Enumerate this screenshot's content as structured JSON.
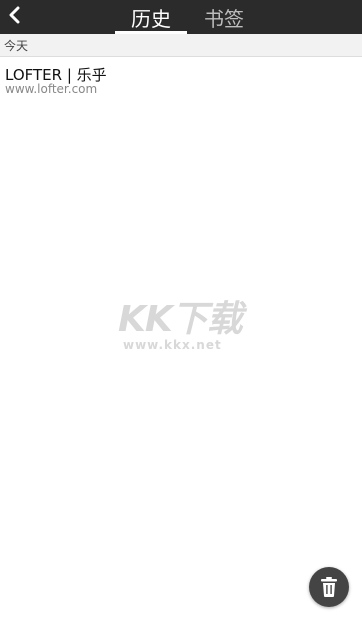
{
  "header": {
    "back_icon": "chevron-left-icon",
    "tabs": [
      {
        "label": "历史",
        "active": true
      },
      {
        "label": "书签",
        "active": false
      }
    ],
    "background_color": "#2b2b2b"
  },
  "history": {
    "sections": [
      {
        "label": "今天",
        "items": [
          {
            "title": "LOFTER | 乐乎",
            "url": "www.lofter.com"
          }
        ]
      }
    ]
  },
  "watermark": {
    "logo_text": "KK下载",
    "url_text": "www.kkx.net"
  },
  "actions": {
    "clear_icon": "trash-icon"
  }
}
